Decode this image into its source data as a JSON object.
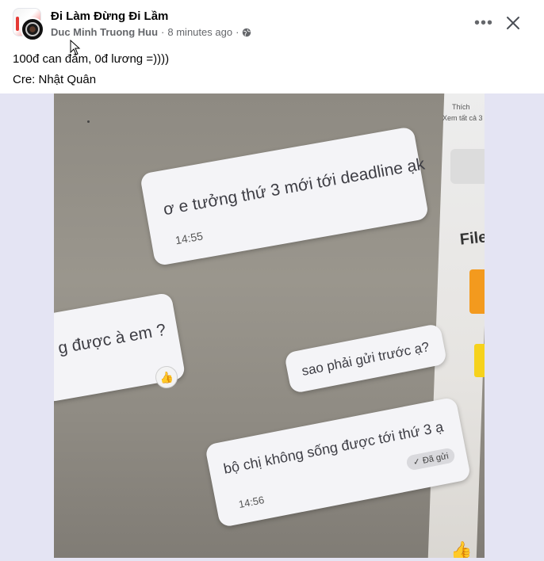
{
  "post": {
    "group_name": "Đi Làm Đừng Đi Lầm",
    "author": "Duc Minh Truong Huu",
    "time_ago": "8 minutes ago",
    "separator": "·",
    "caption_line1": "100đ can đảm, 0đ lương =))))",
    "caption_line2": "Cre: Nhật Quân"
  },
  "header_actions": {
    "more_label": "•••",
    "close_icon": "close-icon"
  },
  "photo": {
    "bubble1_text": "ơ e tưởng thứ 3 mới tới deadline ạk",
    "bubble1_time": "14:55",
    "bubble2_text": "g được à em ?",
    "bubble3_text": "sao phải gửi trước ạ?",
    "bubble4_text": "bộ chị không sống được tới thứ 3 ạ",
    "bubble4_time": "14:56",
    "bubble4_status": "✓ Đã gửi",
    "right_panel_file": "File",
    "right_panel_small1": "Thích",
    "right_panel_small2": "Xem tất cả 3"
  },
  "colors": {
    "accent_red": "#e53935",
    "text_secondary": "#65676b",
    "media_bg": "#e4e4f3"
  }
}
